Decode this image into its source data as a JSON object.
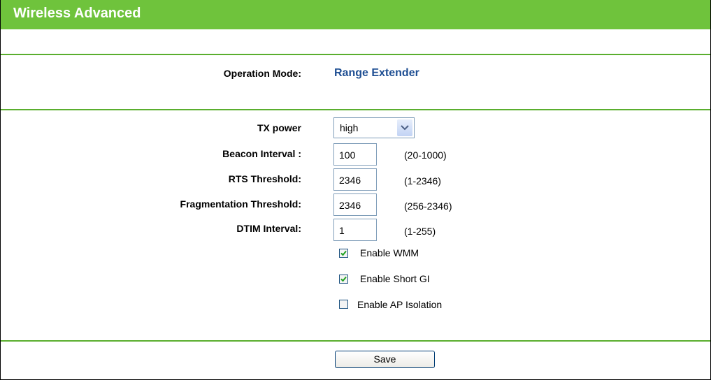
{
  "page": {
    "title": "Wireless Advanced"
  },
  "operation": {
    "label": "Operation Mode:",
    "value": "Range Extender"
  },
  "form": {
    "tx_power": {
      "label": "TX power",
      "selected": "high"
    },
    "beacon": {
      "label": "Beacon Interval :",
      "value": "100",
      "range": "(20-1000)"
    },
    "rts": {
      "label": "RTS Threshold:",
      "value": "2346",
      "range": "(1-2346)"
    },
    "frag": {
      "label": "Fragmentation Threshold:",
      "value": "2346",
      "range": "(256-2346)"
    },
    "dtim": {
      "label": "DTIM Interval:",
      "value": "1",
      "range": "(1-255)"
    }
  },
  "options": {
    "wmm": {
      "label": "Enable WMM",
      "checked": true
    },
    "short_gi": {
      "label": "Enable Short GI",
      "checked": true
    },
    "ap_isolation": {
      "label": "Enable AP Isolation",
      "checked": false
    }
  },
  "actions": {
    "save_label": "Save"
  },
  "colors": {
    "header": "#6fc33c",
    "divider": "#5aae2e",
    "mode_value": "#1f4f93"
  }
}
